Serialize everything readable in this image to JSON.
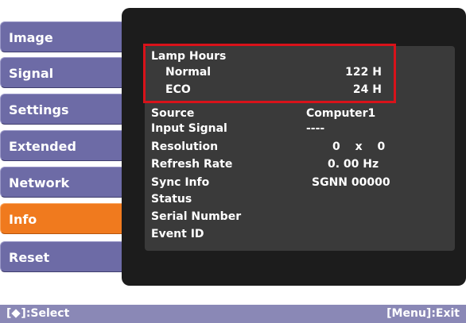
{
  "menu": {
    "items": [
      {
        "label": "Image",
        "active": false
      },
      {
        "label": "Signal",
        "active": false
      },
      {
        "label": "Settings",
        "active": false
      },
      {
        "label": "Extended",
        "active": false
      },
      {
        "label": "Network",
        "active": false
      },
      {
        "label": "Info",
        "active": true
      },
      {
        "label": "Reset",
        "active": false
      }
    ]
  },
  "info": {
    "lamp_hours": {
      "label": "Lamp Hours"
    },
    "normal": {
      "label": "Normal",
      "value": "122 H"
    },
    "eco": {
      "label": "ECO",
      "value": "24 H"
    },
    "source": {
      "label": "Source",
      "value": "Computer1"
    },
    "input_signal": {
      "label": "Input Signal",
      "value": "----"
    },
    "resolution": {
      "label": "Resolution",
      "value": "0 x 0"
    },
    "refresh_rate": {
      "label": "Refresh Rate",
      "value": "0. 00 Hz"
    },
    "sync_info": {
      "label": "Sync Info",
      "value": "SGNN 00000"
    },
    "status": {
      "label": "Status",
      "value": ""
    },
    "serial_number": {
      "label": "Serial Number",
      "value": ""
    },
    "event_id": {
      "label": "Event ID",
      "value": ""
    }
  },
  "footer": {
    "select_label": ":Select",
    "exit_label": "[Menu]:Exit"
  },
  "colors": {
    "tab": "#6d6ba6",
    "tab_active": "#f07a1e",
    "panel": "#1c1c1c",
    "highlight": "#d8121a",
    "footer": "#8a88b6"
  }
}
